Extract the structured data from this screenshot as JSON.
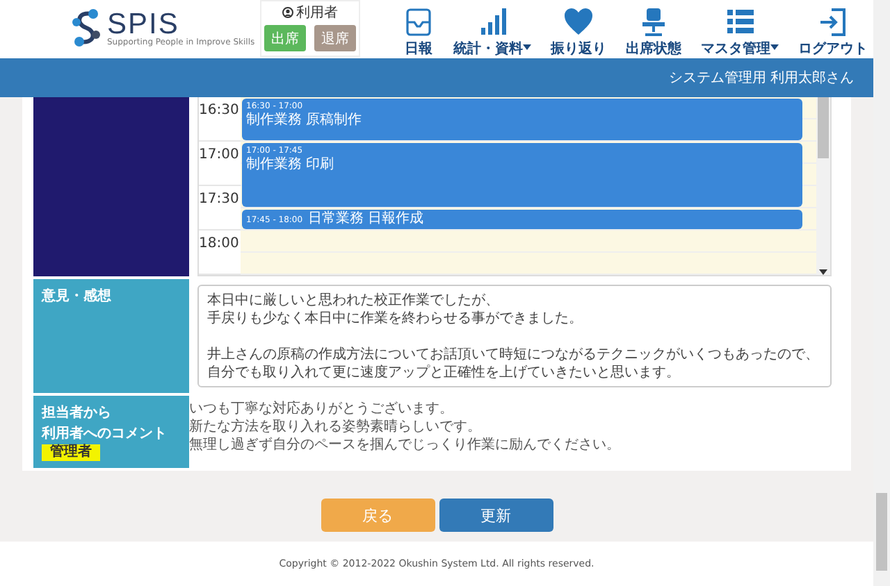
{
  "header": {
    "logo": {
      "text": "SPIS",
      "tagline": "Supporting People in Improve Skills"
    },
    "user": {
      "label": "利用者",
      "buttons": [
        {
          "label": "出席",
          "kind": "attend"
        },
        {
          "label": "退席",
          "kind": "leave"
        }
      ]
    },
    "nav": [
      {
        "label": "日報",
        "dropdown": false
      },
      {
        "label": "統計・資料",
        "dropdown": true
      },
      {
        "label": "振り返り",
        "dropdown": false
      },
      {
        "label": "出席状態",
        "dropdown": false
      },
      {
        "label": "マスタ管理",
        "dropdown": true
      },
      {
        "label": "ログアウト",
        "dropdown": false
      }
    ]
  },
  "banner": {
    "user_name": "システム管理用 利用太郎さん"
  },
  "schedule": {
    "slots": [
      "16:30",
      "17:00",
      "17:30",
      "18:00"
    ],
    "events": [
      {
        "time": "16:30 - 17:00",
        "title": "制作業務 原稿制作"
      },
      {
        "time": "17:00 - 17:45",
        "title": "制作業務 印刷"
      },
      {
        "time": "17:45 - 18:00",
        "title": "日常業務 日報作成"
      }
    ]
  },
  "opinion": {
    "label": "意見・感想",
    "paragraphs": [
      [
        "本日中に厳しいと思われた校正作業でしたが、",
        "手戻りも少なく本日中に作業を終わらせる事ができました。"
      ],
      [
        "井上さんの原稿の作成方法についてお話頂いて時短につながるテクニックがいくつもあったので、",
        "自分でも取り入れて更に速度アップと正確性を上げていきたいと思います。"
      ]
    ]
  },
  "comment": {
    "label_lines": [
      "担当者から",
      "利用者へのコメント"
    ],
    "badge": "管理者",
    "lines": [
      "いつも丁寧な対応ありがとうございます。",
      "新たな方法を取り入れる姿勢素晴らしいです。",
      "無理し過ぎず自分のペースを掴んでじっくり作業に励んでください。"
    ]
  },
  "buttons": [
    {
      "label": "戻る",
      "kind": "back"
    },
    {
      "label": "更新",
      "kind": "primary"
    }
  ],
  "footer": {
    "copyright": "Copyright © 2012-2022 Okushin System Ltd. All rights reserved."
  }
}
